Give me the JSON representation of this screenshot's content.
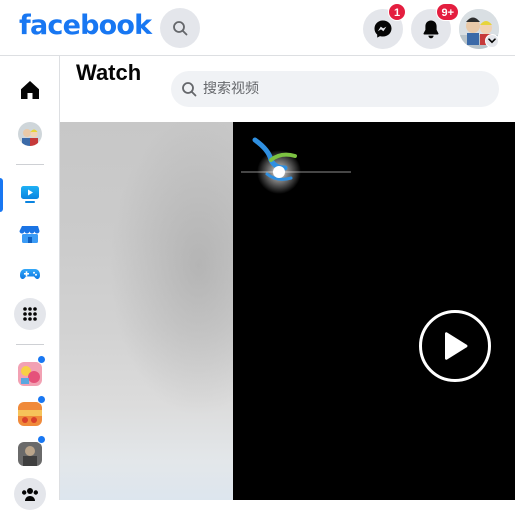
{
  "topbar": {
    "logo_text": "facebook",
    "messenger_badge": "1",
    "notifications_badge": "9+"
  },
  "watch": {
    "title": "Watch",
    "search_placeholder": "搜索视频"
  },
  "rail": {
    "items": [
      {
        "name": "home",
        "icon": "home-icon"
      },
      {
        "name": "profile",
        "icon": "avatar"
      },
      {
        "name": "watch",
        "icon": "watch-icon",
        "active": true
      },
      {
        "name": "marketplace",
        "icon": "marketplace-icon"
      },
      {
        "name": "gaming",
        "icon": "gaming-icon"
      },
      {
        "name": "menu",
        "icon": "grid-menu-icon"
      },
      {
        "name": "group-1",
        "icon": "group-thumb",
        "unread": true
      },
      {
        "name": "group-2",
        "icon": "group-thumb",
        "unread": true
      },
      {
        "name": "group-3",
        "icon": "group-thumb",
        "unread": true
      },
      {
        "name": "groups",
        "icon": "groups-icon"
      }
    ]
  },
  "colors": {
    "brand": "#1877f2",
    "badge": "#e41e3f",
    "button_bg": "#e4e6eb",
    "search_bg": "#f0f2f5"
  }
}
